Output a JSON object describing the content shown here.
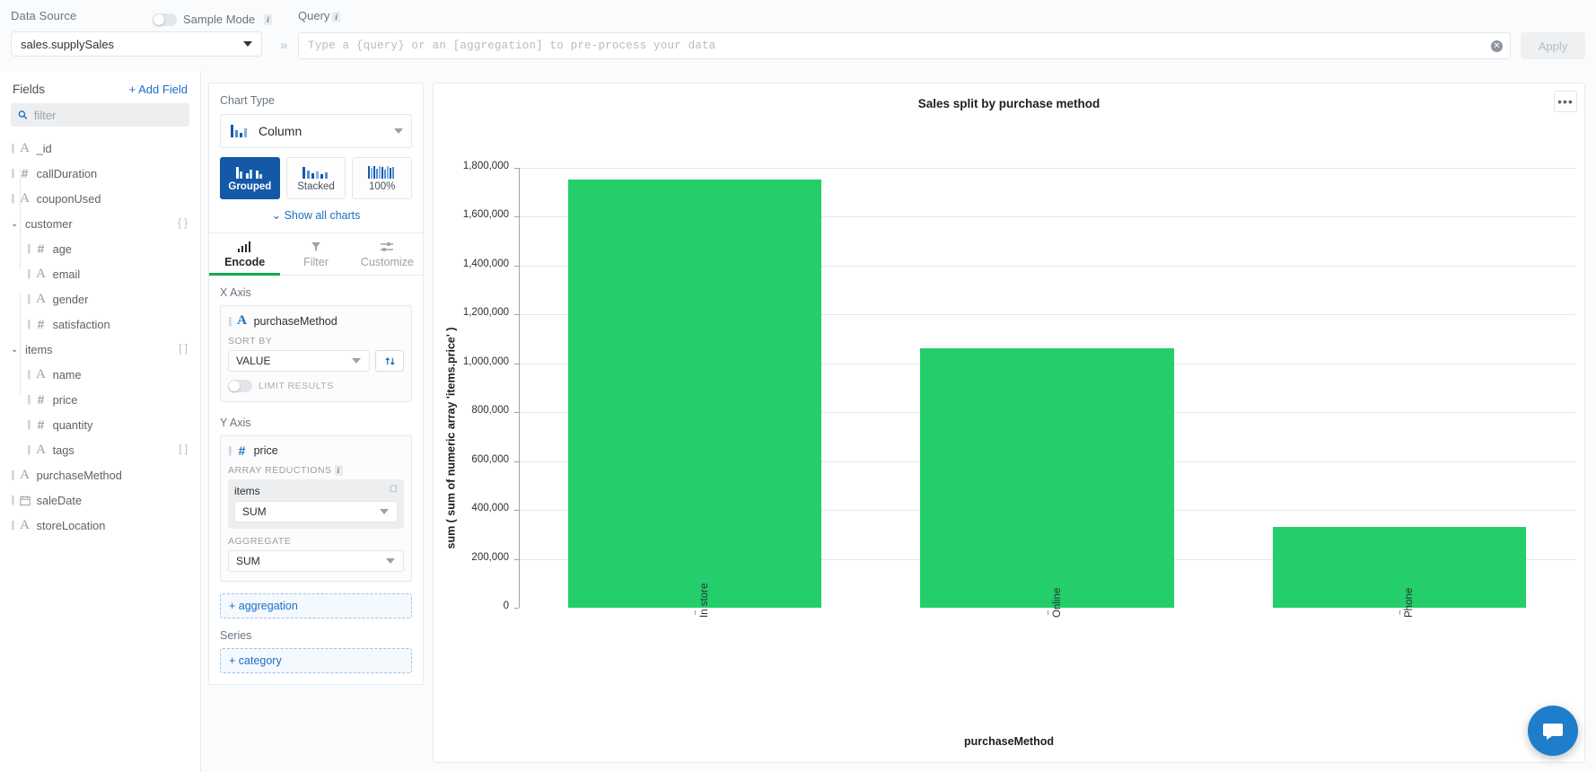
{
  "topbar": {
    "data_source_label": "Data Source",
    "sample_mode_label": "Sample Mode",
    "info_badge": "i",
    "data_source_value": "sales.supplySales",
    "query_label": "Query",
    "query_info_badge": "i",
    "query_value": "",
    "query_placeholder": "Type a {query} or an [aggregation] to pre-process your data",
    "apply_label": "Apply",
    "chevron": "»"
  },
  "fields_panel": {
    "title": "Fields",
    "add_field_label": "+ Add Field",
    "filter_placeholder": "filter",
    "items": [
      {
        "label": "_id",
        "type": "string",
        "level": 0,
        "badge": ""
      },
      {
        "label": "callDuration",
        "type": "number",
        "level": 0,
        "badge": ""
      },
      {
        "label": "couponUsed",
        "type": "string",
        "level": 0,
        "badge": ""
      },
      {
        "label": "customer",
        "type": "object",
        "level": 0,
        "badge": "{ }",
        "expanded": true
      },
      {
        "label": "age",
        "type": "number",
        "level": 1,
        "badge": ""
      },
      {
        "label": "email",
        "type": "string",
        "level": 1,
        "badge": ""
      },
      {
        "label": "gender",
        "type": "string",
        "level": 1,
        "badge": ""
      },
      {
        "label": "satisfaction",
        "type": "number",
        "level": 1,
        "badge": ""
      },
      {
        "label": "items",
        "type": "array",
        "level": 0,
        "badge": "[ ]",
        "expanded": true
      },
      {
        "label": "name",
        "type": "string",
        "level": 1,
        "badge": ""
      },
      {
        "label": "price",
        "type": "number",
        "level": 1,
        "badge": ""
      },
      {
        "label": "quantity",
        "type": "number",
        "level": 1,
        "badge": ""
      },
      {
        "label": "tags",
        "type": "string",
        "level": 1,
        "badge": "[ ]"
      },
      {
        "label": "purchaseMethod",
        "type": "string",
        "level": 0,
        "badge": ""
      },
      {
        "label": "saleDate",
        "type": "date",
        "level": 0,
        "badge": ""
      },
      {
        "label": "storeLocation",
        "type": "string",
        "level": 0,
        "badge": ""
      }
    ]
  },
  "config": {
    "chart_type_label": "Chart Type",
    "chart_type_value": "Column",
    "variants": [
      {
        "label": "Grouped",
        "active": true
      },
      {
        "label": "Stacked",
        "active": false
      },
      {
        "label": "100%",
        "active": false
      }
    ],
    "show_all_charts": "Show all charts",
    "tabs": [
      {
        "label": "Encode",
        "active": true
      },
      {
        "label": "Filter",
        "active": false
      },
      {
        "label": "Customize",
        "active": false
      }
    ],
    "x_axis": {
      "title": "X Axis",
      "field": "purchaseMethod",
      "field_type": "string",
      "sort_by_label": "SORT BY",
      "sort_by_value": "VALUE",
      "limit_results_label": "LIMIT RESULTS",
      "limit_results_on": false
    },
    "y_axis": {
      "title": "Y Axis",
      "field": "price",
      "field_type": "number",
      "array_reductions_label": "ARRAY REDUCTIONS",
      "array_reductions_info": "i",
      "reduction_field": "items",
      "reduction_value": "SUM",
      "aggregate_label": "AGGREGATE",
      "aggregate_value": "SUM",
      "add_aggregation_label": "+ aggregation"
    },
    "series": {
      "title": "Series",
      "add_category_label": "+ category"
    }
  },
  "chart_card": {
    "menu_icon": "•••"
  },
  "chart_data": {
    "type": "bar",
    "title": "Sales split by purchase method",
    "xlabel": "purchaseMethod",
    "ylabel": "sum ( sum of numeric array 'items.price' )",
    "categories": [
      "In store",
      "Online",
      "Phone"
    ],
    "values": [
      1752000,
      1060000,
      330000
    ],
    "ylim": [
      0,
      1800000
    ],
    "yticks": [
      0,
      200000,
      400000,
      600000,
      800000,
      1000000,
      1200000,
      1400000,
      1600000,
      1800000
    ],
    "ytick_labels": [
      "0",
      "200,000",
      "400,000",
      "600,000",
      "800,000",
      "1,000,000",
      "1,200,000",
      "1,400,000",
      "1,600,000",
      "1,800,000"
    ],
    "bar_color": "#23ce6b",
    "grid": true,
    "legend": "none"
  },
  "chat": {
    "icon": "chat-icon"
  }
}
